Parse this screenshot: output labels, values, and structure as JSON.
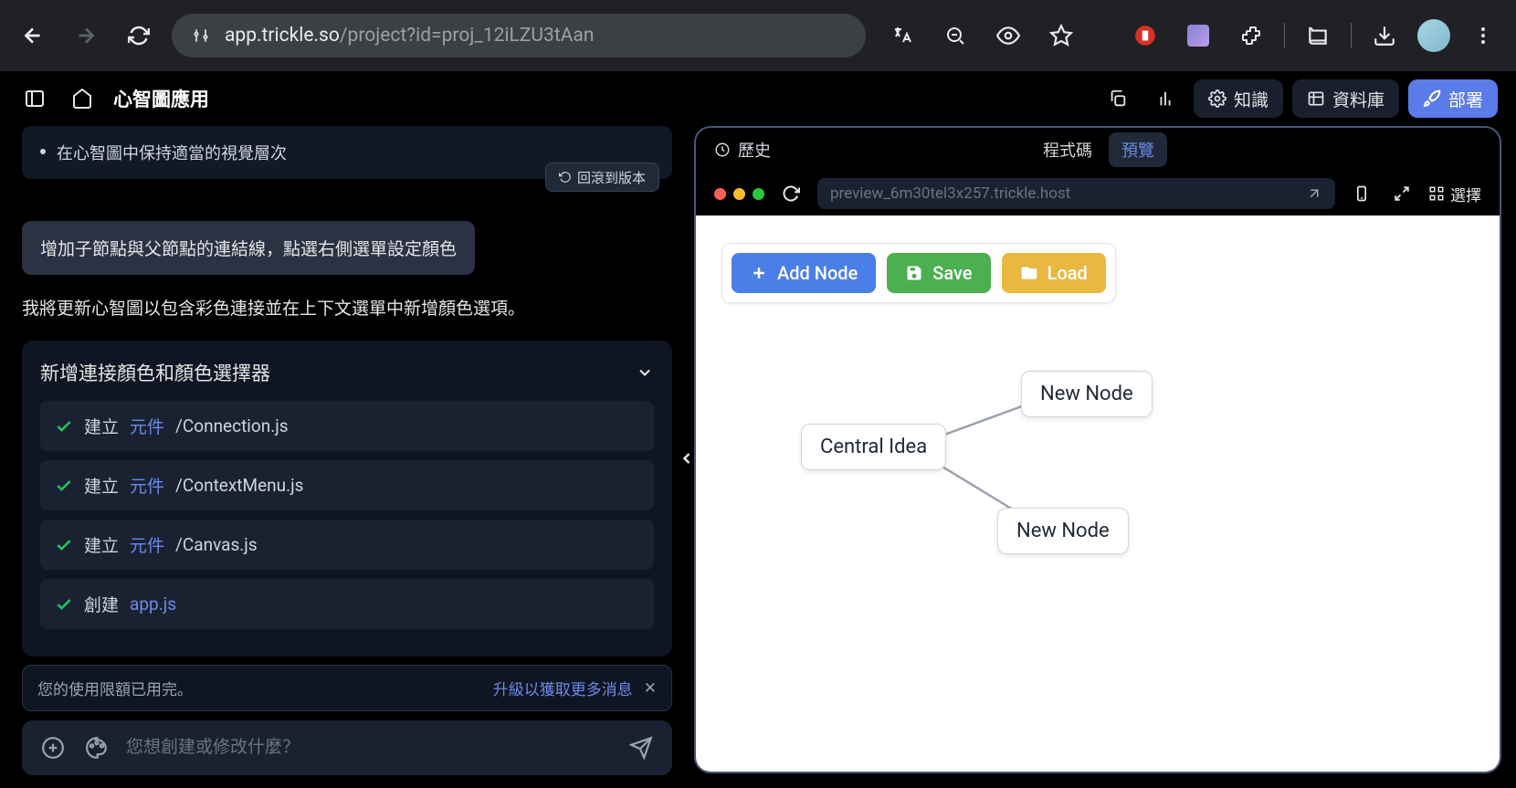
{
  "browser": {
    "url_host": "app.trickle.so",
    "url_path": "/project?id=proj_12iLZU3tAan"
  },
  "app": {
    "title": "心智圖應用",
    "knowledge": "知識",
    "database": "資料庫",
    "deploy": "部署"
  },
  "chat": {
    "bullet": "在心智圖中保持適當的視覺層次",
    "revert": "回滾到版本",
    "user_msg": "增加子節點與父節點的連結線，點選右側選單設定顏色",
    "assist": "我將更新心智圖以包含彩色連接並在上下文選單中新增顏色選項。",
    "task_title": "新增連接顏色和顏色選擇器",
    "tasks": [
      {
        "prefix": "建立",
        "link": "元件",
        "suffix": "/Connection.js"
      },
      {
        "prefix": "建立",
        "link": "元件",
        "suffix": "/ContextMenu.js"
      },
      {
        "prefix": "建立",
        "link": "元件",
        "suffix": "/Canvas.js"
      },
      {
        "prefix": "創建",
        "link": "app.js",
        "suffix": ""
      }
    ],
    "quota_msg": "您的使用限額已用完。",
    "quota_upgrade": "升級以獲取更多消息",
    "composer_placeholder": "您想創建或修改什麼？"
  },
  "preview": {
    "history": "歷史",
    "code": "程式碼",
    "preview": "預覽",
    "url": "preview_6m30tel3x257.trickle.host",
    "select": "選擇",
    "buttons": {
      "add": "Add Node",
      "save": "Save",
      "load": "Load"
    },
    "nodes": {
      "central": "Central Idea",
      "n1": "New Node",
      "n2": "New Node"
    }
  }
}
